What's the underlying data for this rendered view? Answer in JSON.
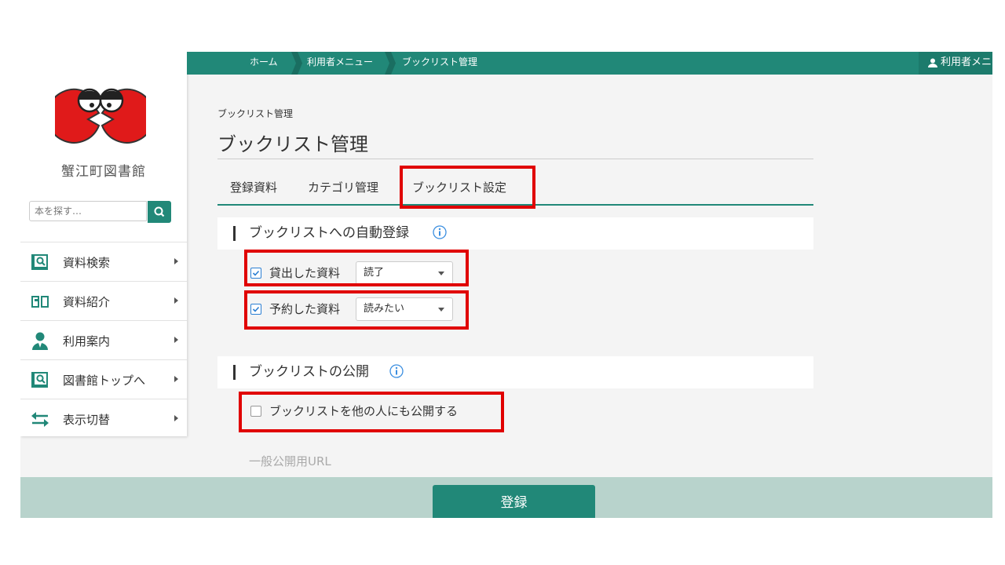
{
  "colors": {
    "accent": "#218878",
    "highlight": "#e00000",
    "footer": "#b8d3cc",
    "checkbox": "#2b7fd3"
  },
  "sidebar": {
    "library_name": "蟹江町図書館",
    "search_placeholder": "本を探す…",
    "items": [
      {
        "label": "資料検索",
        "icon": "book-search-icon"
      },
      {
        "label": "資料紹介",
        "icon": "open-book-icon"
      },
      {
        "label": "利用案内",
        "icon": "person-icon"
      },
      {
        "label": "図書館トップへ",
        "icon": "book-search-icon"
      },
      {
        "label": "表示切替",
        "icon": "swap-arrows-icon"
      }
    ]
  },
  "breadcrumb": [
    "ホーム",
    "利用者メニュー",
    "ブックリスト管理"
  ],
  "user_menu_label": "利用者メニュー",
  "page": {
    "small_title": "ブックリスト管理",
    "title": "ブックリスト管理",
    "tabs": [
      "登録資料",
      "カテゴリ管理",
      "ブックリスト設定"
    ],
    "active_tab": "ブックリスト設定"
  },
  "auto_register": {
    "title": "ブックリストへの自動登録",
    "rows": [
      {
        "label": "貸出した資料",
        "checked": true,
        "value": "読了"
      },
      {
        "label": "予約した資料",
        "checked": true,
        "value": "読みたい"
      }
    ]
  },
  "publish": {
    "title": "ブックリストの公開",
    "checkbox_label": "ブックリストを他の人にも公開する",
    "checked": false,
    "url_label": "一般公開用URL"
  },
  "submit_label": "登録"
}
